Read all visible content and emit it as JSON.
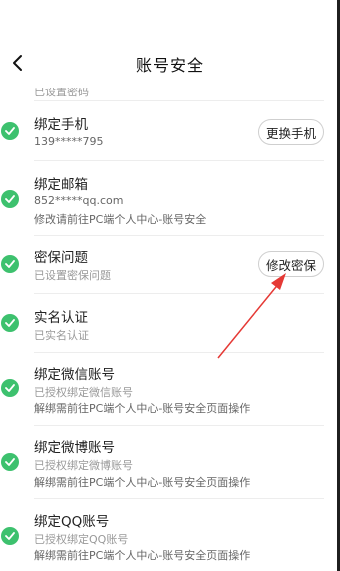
{
  "nav": {
    "title": "账号安全"
  },
  "clipped_text": "已设置密码",
  "rows": [
    {
      "title": "绑定手机",
      "subs": [
        "139*****795"
      ],
      "button": "更换手机"
    },
    {
      "title": "绑定邮箱",
      "subs": [
        "852*****qq.com",
        "修改请前往PC端个人中心-账号安全"
      ]
    },
    {
      "title": "密保问题",
      "subs": [
        "已设置密保问题"
      ],
      "button": "修改密保"
    },
    {
      "title": "实名认证",
      "subs": [
        "已实名认证"
      ]
    },
    {
      "title": "绑定微信账号",
      "subs": [
        "已授权绑定微信账号",
        "解绑需前往PC端个人中心-账号安全页面操作"
      ]
    },
    {
      "title": "绑定微博账号",
      "subs": [
        "已授权绑定微博账号",
        "解绑需前往PC端个人中心-账号安全页面操作"
      ]
    },
    {
      "title": "绑定QQ账号",
      "subs": [
        "已授权绑定QQ账号",
        "解绑需前往PC端个人中心-账号安全页面操作"
      ]
    }
  ],
  "colors": {
    "check_green": "#3dc16e",
    "annotation_arrow": "#e53935"
  },
  "icons": {
    "back": "chevron-left-icon",
    "check": "check-circle-icon"
  }
}
